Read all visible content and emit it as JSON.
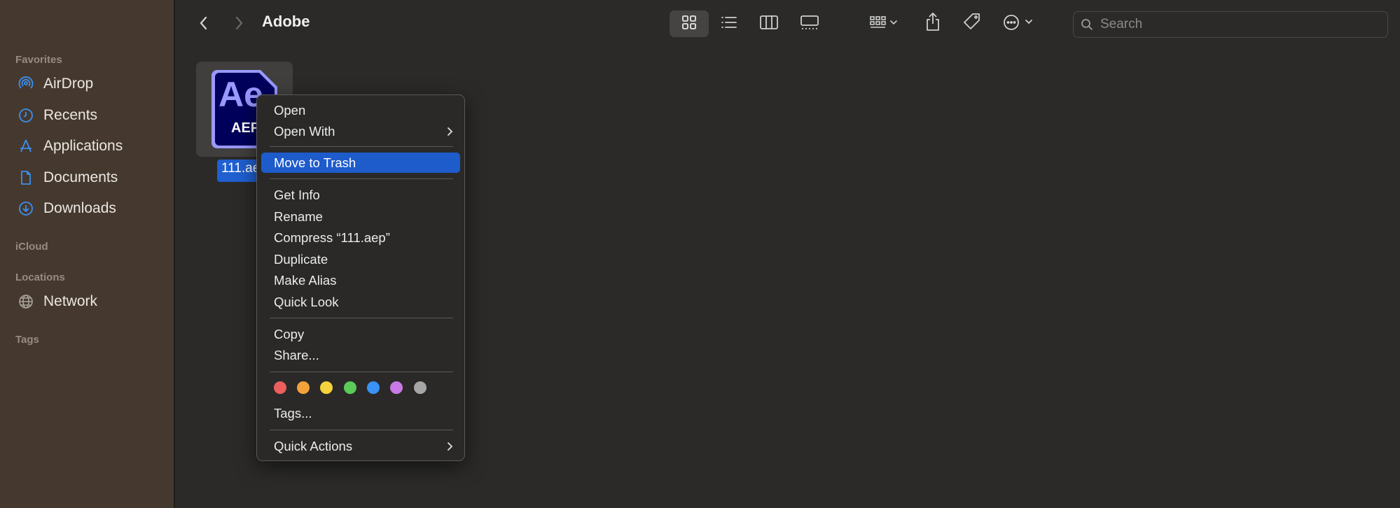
{
  "toolbar": {
    "title": "Adobe",
    "search_placeholder": "Search",
    "icons": [
      "back-icon",
      "forward-icon",
      "icon-view-icon",
      "list-view-icon",
      "column-view-icon",
      "gallery-view-icon",
      "group-icon",
      "share-icon",
      "tag-icon",
      "more-icon"
    ]
  },
  "sidebar": {
    "sections": {
      "favorites": "Favorites",
      "icloud": "iCloud",
      "locations": "Locations",
      "tags": "Tags"
    },
    "favorites": [
      {
        "label": "AirDrop",
        "icon": "airdrop-icon"
      },
      {
        "label": "Recents",
        "icon": "clock-icon"
      },
      {
        "label": "Applications",
        "icon": "applications-icon"
      },
      {
        "label": "Documents",
        "icon": "document-icon"
      },
      {
        "label": "Downloads",
        "icon": "download-icon"
      }
    ],
    "locations": [
      {
        "label": "Network",
        "icon": "globe-icon"
      }
    ]
  },
  "file": {
    "name": "111.ae",
    "icon_top": "Ae",
    "icon_bottom": "AEP"
  },
  "context_menu": {
    "open": "Open",
    "open_with": "Open With",
    "move_to_trash": "Move to Trash",
    "get_info": "Get Info",
    "rename": "Rename",
    "compress": "Compress “111.aep”",
    "duplicate": "Duplicate",
    "make_alias": "Make Alias",
    "quick_look": "Quick Look",
    "copy": "Copy",
    "share": "Share...",
    "tags": "Tags...",
    "quick_actions": "Quick Actions",
    "tag_colors": [
      "#ec5f5d",
      "#f4a33c",
      "#f6d23c",
      "#5bcb58",
      "#3a92f6",
      "#c97ae6",
      "#a6a6a6"
    ]
  },
  "colors": {
    "accent": "#1e5bcb",
    "sidebar_icon": "#3b8ff0"
  }
}
